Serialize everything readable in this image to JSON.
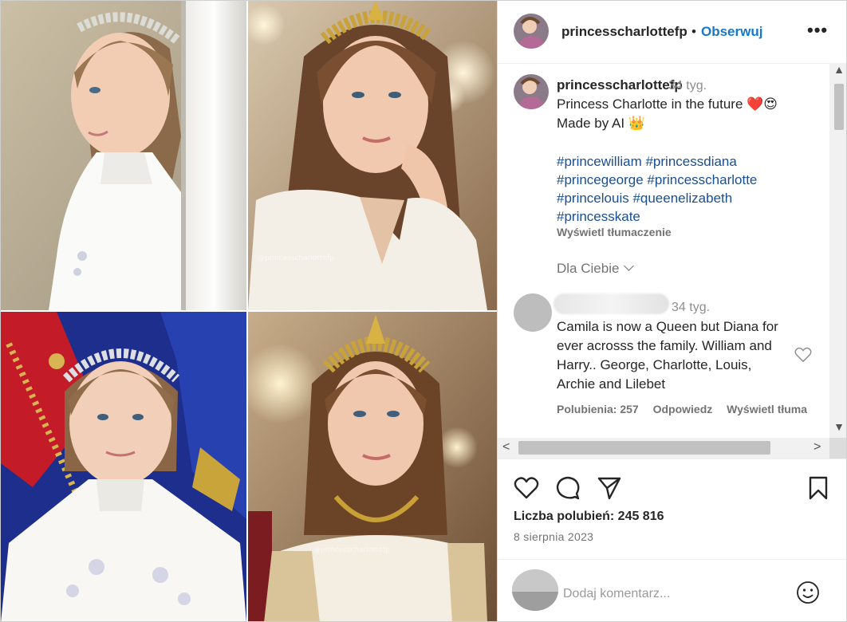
{
  "post": {
    "username": "princesscharlottefp",
    "separator": "•",
    "follow_label": "Obserwuj",
    "more_label": "•••",
    "watermark": "@princesscharlottefp"
  },
  "caption": {
    "username": "princesscharlottefp",
    "time": "34 tyg.",
    "lines": [
      "Princess Charlotte in the future ❤️😍",
      "Made by AI 👑"
    ],
    "hashtags": [
      "#princewilliam #princessdiana",
      "#princegeorge #princesscharlotte",
      "#princelouis #queenelizabeth",
      "#princesskate"
    ],
    "translate_label": "Wyświetl tłumaczenie",
    "for_you_label": "Dla Ciebie"
  },
  "comment": {
    "time": "34 tyg.",
    "text": "Camila is now a Queen but Diana for ever acrosss the family. William and Harry.. George, Charlotte, Louis, Archie and Lilebet",
    "likes_label": "Polubienia: 257",
    "reply_label": "Odpowiedz",
    "translate_label": "Wyświetl tłuma"
  },
  "scrollbar": {
    "up": "▲",
    "down": "▼",
    "left": "<",
    "right": ">"
  },
  "stats": {
    "likes_text": "Liczba polubień: 245 816",
    "date": "8 sierpnia 2023"
  },
  "add_comment": {
    "placeholder": "Dodaj komentarz..."
  },
  "icons": [
    "heart-icon",
    "comment-icon",
    "share-icon",
    "bookmark-icon",
    "emoji-icon"
  ],
  "colors": {
    "link_blue": "#1877c9",
    "hashtag": "#1a4f8f",
    "muted": "#737373",
    "text": "#262626"
  }
}
